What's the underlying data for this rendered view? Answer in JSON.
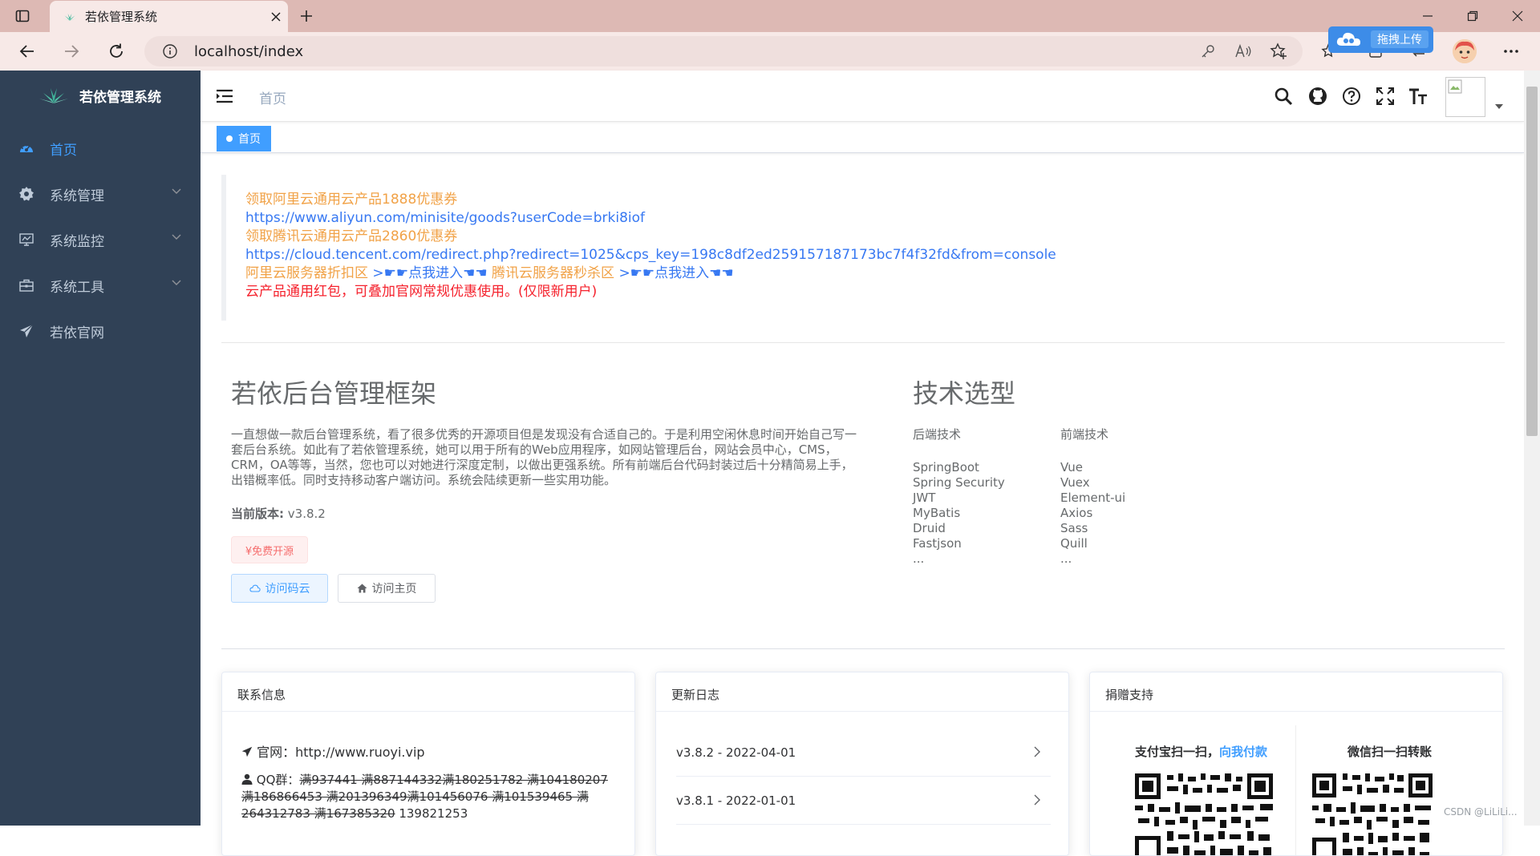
{
  "browser": {
    "tab_title": "若依管理系统",
    "url": "localhost/index",
    "extension_label": "拖拽上传"
  },
  "sidebar": {
    "logo_title": "若依管理系统",
    "items": [
      {
        "label": "首页",
        "icon": "dashboard-icon",
        "active": true
      },
      {
        "label": "系统管理",
        "icon": "gear-icon",
        "has_arrow": true
      },
      {
        "label": "系统监控",
        "icon": "monitor-icon",
        "has_arrow": true
      },
      {
        "label": "系统工具",
        "icon": "toolbox-icon",
        "has_arrow": true
      },
      {
        "label": "若依官网",
        "icon": "paper-plane-icon"
      }
    ],
    "bg_color": "#304156",
    "active_color": "#409eff"
  },
  "header": {
    "breadcrumb": "首页",
    "tag_home": "首页"
  },
  "notice": {
    "aliyun_title": "领取阿里云通用云产品1888优惠券",
    "aliyun_url": "https://www.aliyun.com/minisite/goods?userCode=brki8iof",
    "tencent_title": "领取腾讯云通用云产品2860优惠券",
    "tencent_url": "https://cloud.tencent.com/redirect.php?redirect=1025&cps_key=198c8df2ed259157187173bc7f4f32fd&from=console",
    "aliyun_zone": "阿里云服务器折扣区",
    "enter_link_1": ">☛☛点我进入☚☚",
    "tencent_zone": "腾讯云服务器秒杀区",
    "enter_link_2": ">☛☛点我进入☚☚",
    "red_text": "云产品通用红包，可叠加官网常规优惠使用。(仅限新用户)"
  },
  "intro": {
    "title": "若依后台管理框架",
    "text": "一直想做一款后台管理系统，看了很多优秀的开源项目但是发现没有合适自己的。于是利用空闲休息时间开始自己写一套后台系统。如此有了若依管理系统，她可以用于所有的Web应用程序，如网站管理后台，网站会员中心，CMS，CRM，OA等等，当然，您也可以对她进行深度定制，以做出更强系统。所有前端后台代码封装过后十分精简易上手，出错概率低。同时支持移动客户端访问。系统会陆续更新一些实用功能。",
    "version_label": "当前版本:",
    "version_value": "v3.8.2",
    "free_tag": "¥免费开源",
    "btn_gitee": "访问码云",
    "btn_home": "访问主页"
  },
  "tech": {
    "title": "技术选型",
    "backend_head": "后端技术",
    "backend": [
      "SpringBoot",
      "Spring Security",
      "JWT",
      "MyBatis",
      "Druid",
      "Fastjson",
      "..."
    ],
    "frontend_head": "前端技术",
    "frontend": [
      "Vue",
      "Vuex",
      "Element-ui",
      "Axios",
      "Sass",
      "Quill",
      "..."
    ]
  },
  "cards": {
    "contact": {
      "title": "联系信息",
      "site_label": "官网：",
      "site_url": "http://www.ruoyi.vip",
      "qq_label": "QQ群：",
      "qq_struck": "满937441 满887144332满180251782 满104180207 满186866453 满201396349满101456076 满101539465 满264312783 满167385320",
      "qq_active": "139821253"
    },
    "log": {
      "title": "更新日志",
      "items": [
        "v3.8.2 - 2022-04-01",
        "v3.8.1 - 2022-01-01"
      ]
    },
    "donate": {
      "title": "捐赠支持",
      "alipay_prefix": "支付宝扫一扫，",
      "alipay_link": "向我付款",
      "wechat": "微信扫一扫转账"
    }
  },
  "watermark": "CSDN @LiLiLi..."
}
